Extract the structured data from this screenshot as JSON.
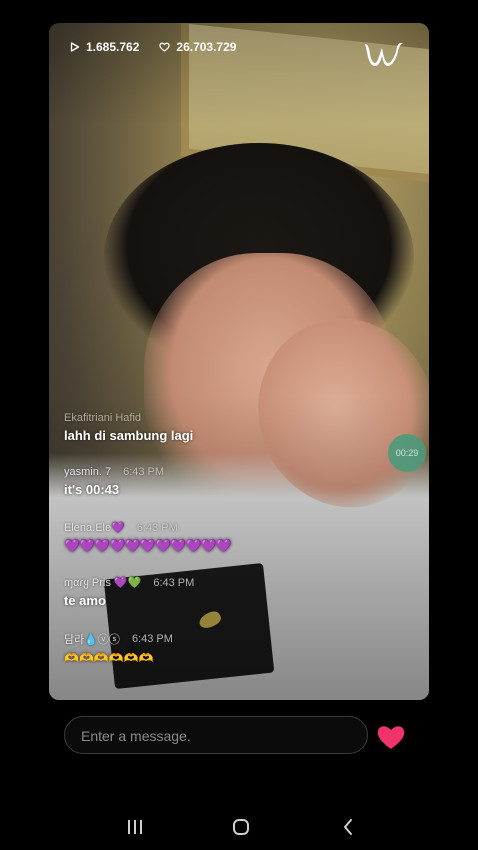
{
  "stats": {
    "plays": "1.685.762",
    "likes": "26.703.729"
  },
  "logo": {
    "icon": "weverse-w-logo"
  },
  "timer": {
    "label": "00:29"
  },
  "chat": [
    {
      "user": "Ekafitriani Hafid",
      "time": "",
      "text": "lahh di sambung lagi"
    },
    {
      "user": "yasmin. 7",
      "time": "6:43 PM",
      "text": "it's 00:43"
    },
    {
      "user": "Elena.Ele💜",
      "time": "6:43 PM",
      "text": "💜💜💜💜💜💜💜💜💜💜💜"
    },
    {
      "user": "ɱαɾყ Pris 💜💚",
      "time": "6:43 PM",
      "text": "te amo"
    },
    {
      "user": "담라💧ⓥⓢ",
      "time": "6:43 PM",
      "text": "🫶🫶🫶🫶🫶🫶"
    }
  ],
  "input": {
    "placeholder": "Enter a message."
  },
  "colors": {
    "heart": "#f0336a",
    "timer_bg": "#4d9a7c",
    "hearts_purple": "#a020f0"
  },
  "nav": {
    "recents": "recents-icon",
    "home": "home-icon",
    "back": "back-icon"
  }
}
